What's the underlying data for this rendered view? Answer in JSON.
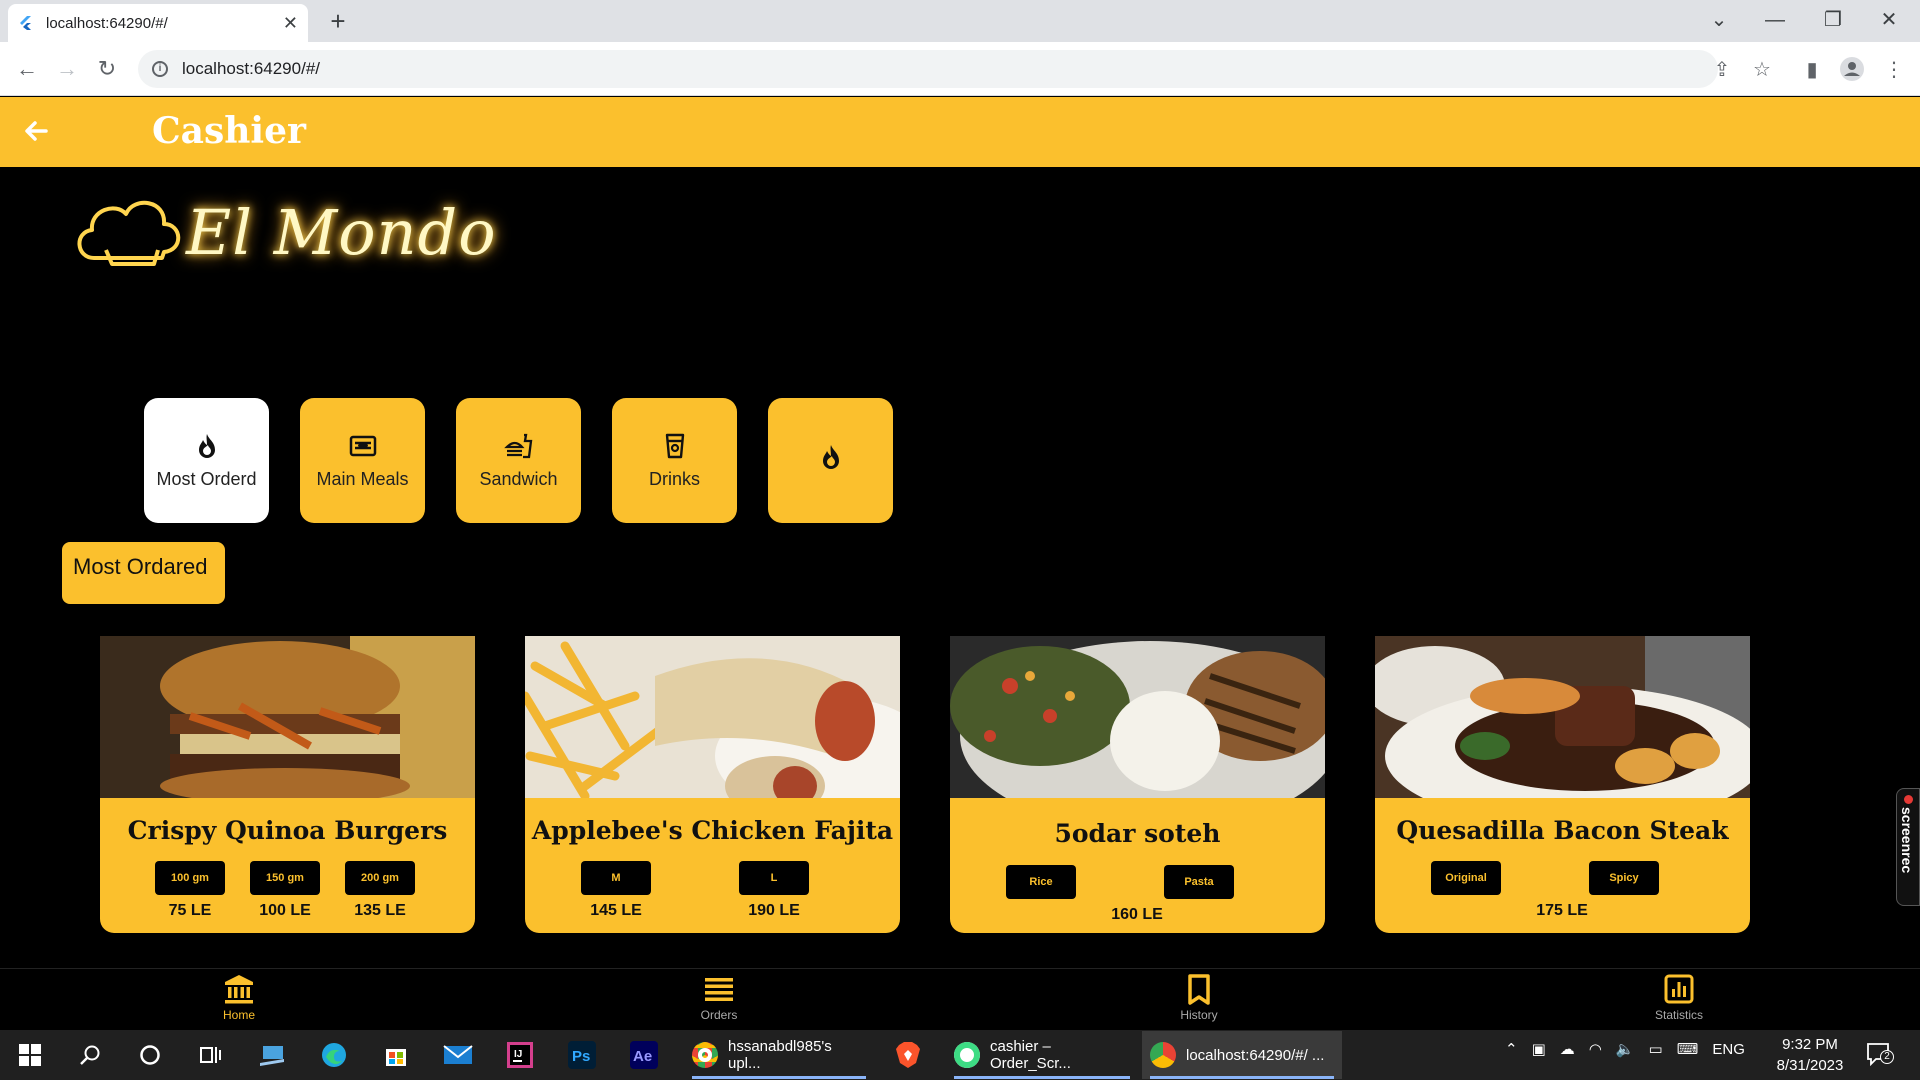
{
  "browser": {
    "tab_title": "localhost:64290/#/",
    "url": "localhost:64290/#/"
  },
  "app": {
    "title": "Cashier",
    "logo_text": "El Mondo",
    "accent": "#fbc02d"
  },
  "categories": [
    {
      "label": "Most Orderd",
      "icon": "flame-icon",
      "active": true
    },
    {
      "label": "Main Meals",
      "icon": "meal-icon",
      "active": false
    },
    {
      "label": "Sandwich",
      "icon": "fastfood-icon",
      "active": false
    },
    {
      "label": "Drinks",
      "icon": "cup-icon",
      "active": false
    },
    {
      "label": "",
      "icon": "flame-icon",
      "active": false
    }
  ],
  "section_title": "Most Ordared",
  "products": [
    {
      "name": "Crispy Quinoa Burgers",
      "options": [
        {
          "label": "100 gm",
          "price": "75 LE"
        },
        {
          "label": "150 gm",
          "price": "100 LE"
        },
        {
          "label": "200 gm",
          "price": "135 LE"
        }
      ]
    },
    {
      "name": "Applebee's Chicken Fajita",
      "options": [
        {
          "label": "M",
          "price": "145 LE"
        },
        {
          "label": "L",
          "price": "190 LE"
        }
      ]
    },
    {
      "name": "5odar soteh",
      "options": [
        {
          "label": "Rice"
        },
        {
          "label": "Pasta"
        }
      ],
      "price": "160 LE"
    },
    {
      "name": "Quesadilla Bacon Steak",
      "options": [
        {
          "label": "Original"
        },
        {
          "label": "Spicy"
        }
      ],
      "price": "175 LE"
    }
  ],
  "bottom_nav": [
    {
      "label": "Home",
      "icon": "bank-icon",
      "active": true
    },
    {
      "label": "Orders",
      "icon": "list-icon",
      "active": false
    },
    {
      "label": "History",
      "icon": "bookmark-icon",
      "active": false
    },
    {
      "label": "Statistics",
      "icon": "stats-icon",
      "active": false
    }
  ],
  "screenrec": "screenrec",
  "taskbar": {
    "windows": [
      "hssanabdl985's upl...",
      "cashier – Order_Scr...",
      "localhost:64290/#/ ..."
    ],
    "lang": "ENG",
    "time": "9:32 PM",
    "date": "8/31/2023",
    "notifications": "2"
  }
}
